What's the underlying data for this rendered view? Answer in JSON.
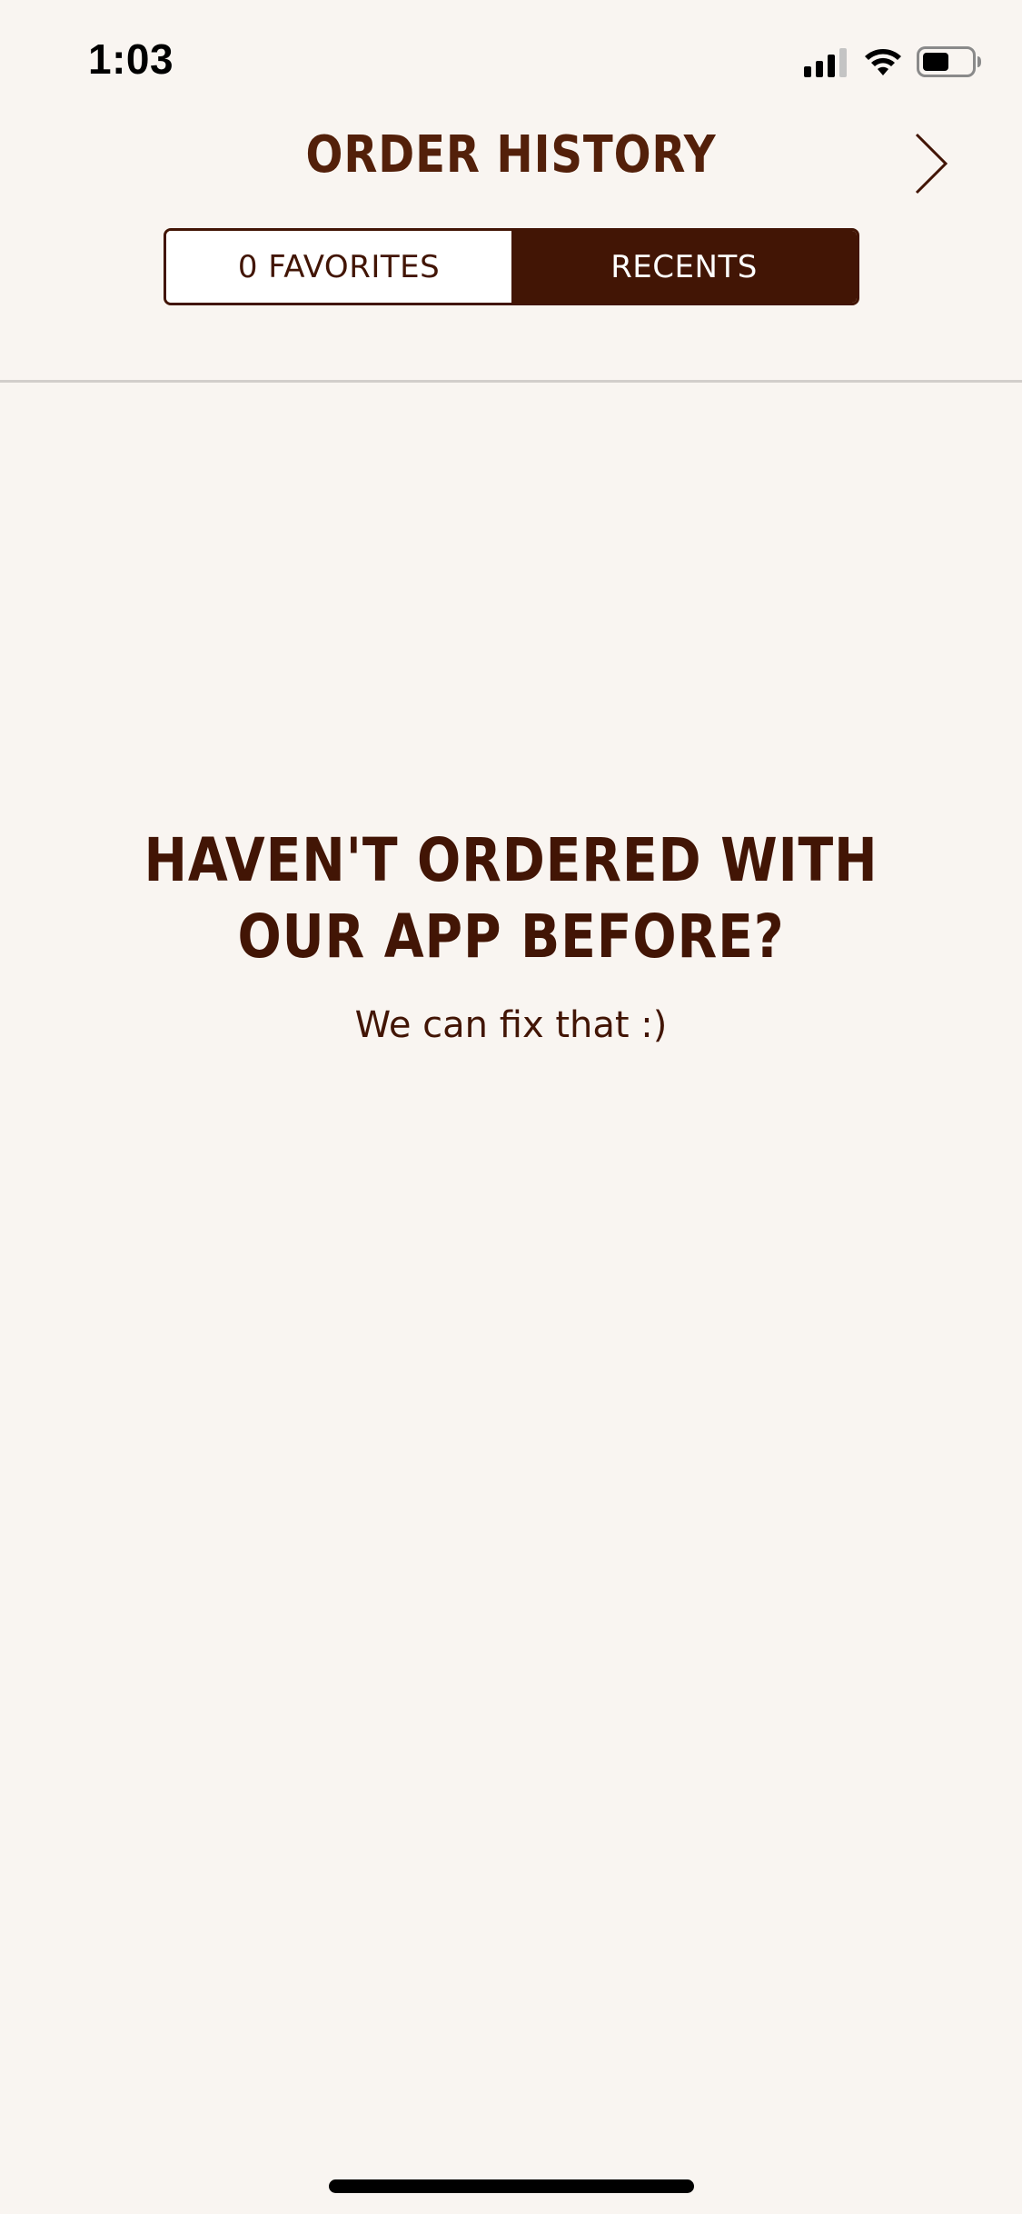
{
  "status_bar": {
    "time": "1:03"
  },
  "header": {
    "title": "ORDER HISTORY"
  },
  "tabs": [
    {
      "label": "0 FAVORITES",
      "active": false
    },
    {
      "label": "RECENTS",
      "active": true
    }
  ],
  "empty_state": {
    "heading_line1": "HAVEN'T ORDERED WITH",
    "heading_line2": "OUR APP BEFORE?",
    "subtext": "We can fix that :)"
  },
  "colors": {
    "background": "#f9f5f1",
    "brand_brown": "#421505",
    "divider": "#d2cecb"
  },
  "icons": {
    "signal": "cellular-signal-icon",
    "wifi": "wifi-icon",
    "battery": "battery-icon",
    "next": "chevron-right-icon"
  }
}
